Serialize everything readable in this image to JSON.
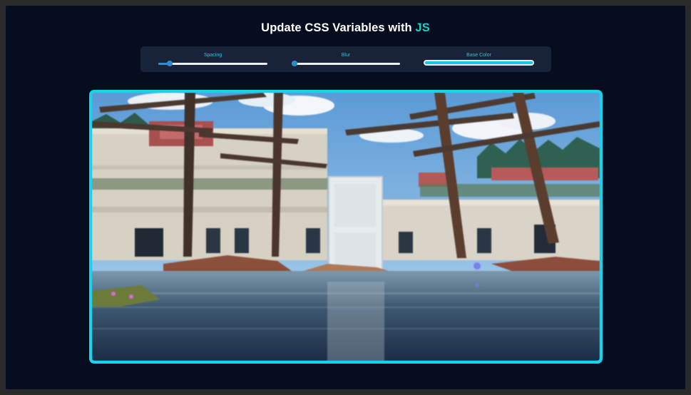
{
  "header": {
    "title_main": "Update CSS Variables with ",
    "title_accent": "JS"
  },
  "controls": {
    "spacing": {
      "label": "Spacing",
      "value": 0.1
    },
    "blur": {
      "label": "Blur",
      "value": 0.0
    },
    "base_color": {
      "label": "Base Color",
      "value": "#18c7e6"
    }
  },
  "colors": {
    "background": "#050d1f",
    "panel": "#18233a",
    "accent": "#18d3c3",
    "label": "#2ec1dc",
    "slider": "#2b8dd1",
    "frame_border": "#1ad0ea"
  },
  "image": {
    "subject": "flooded courtyard with white door and overgrown ruins"
  }
}
